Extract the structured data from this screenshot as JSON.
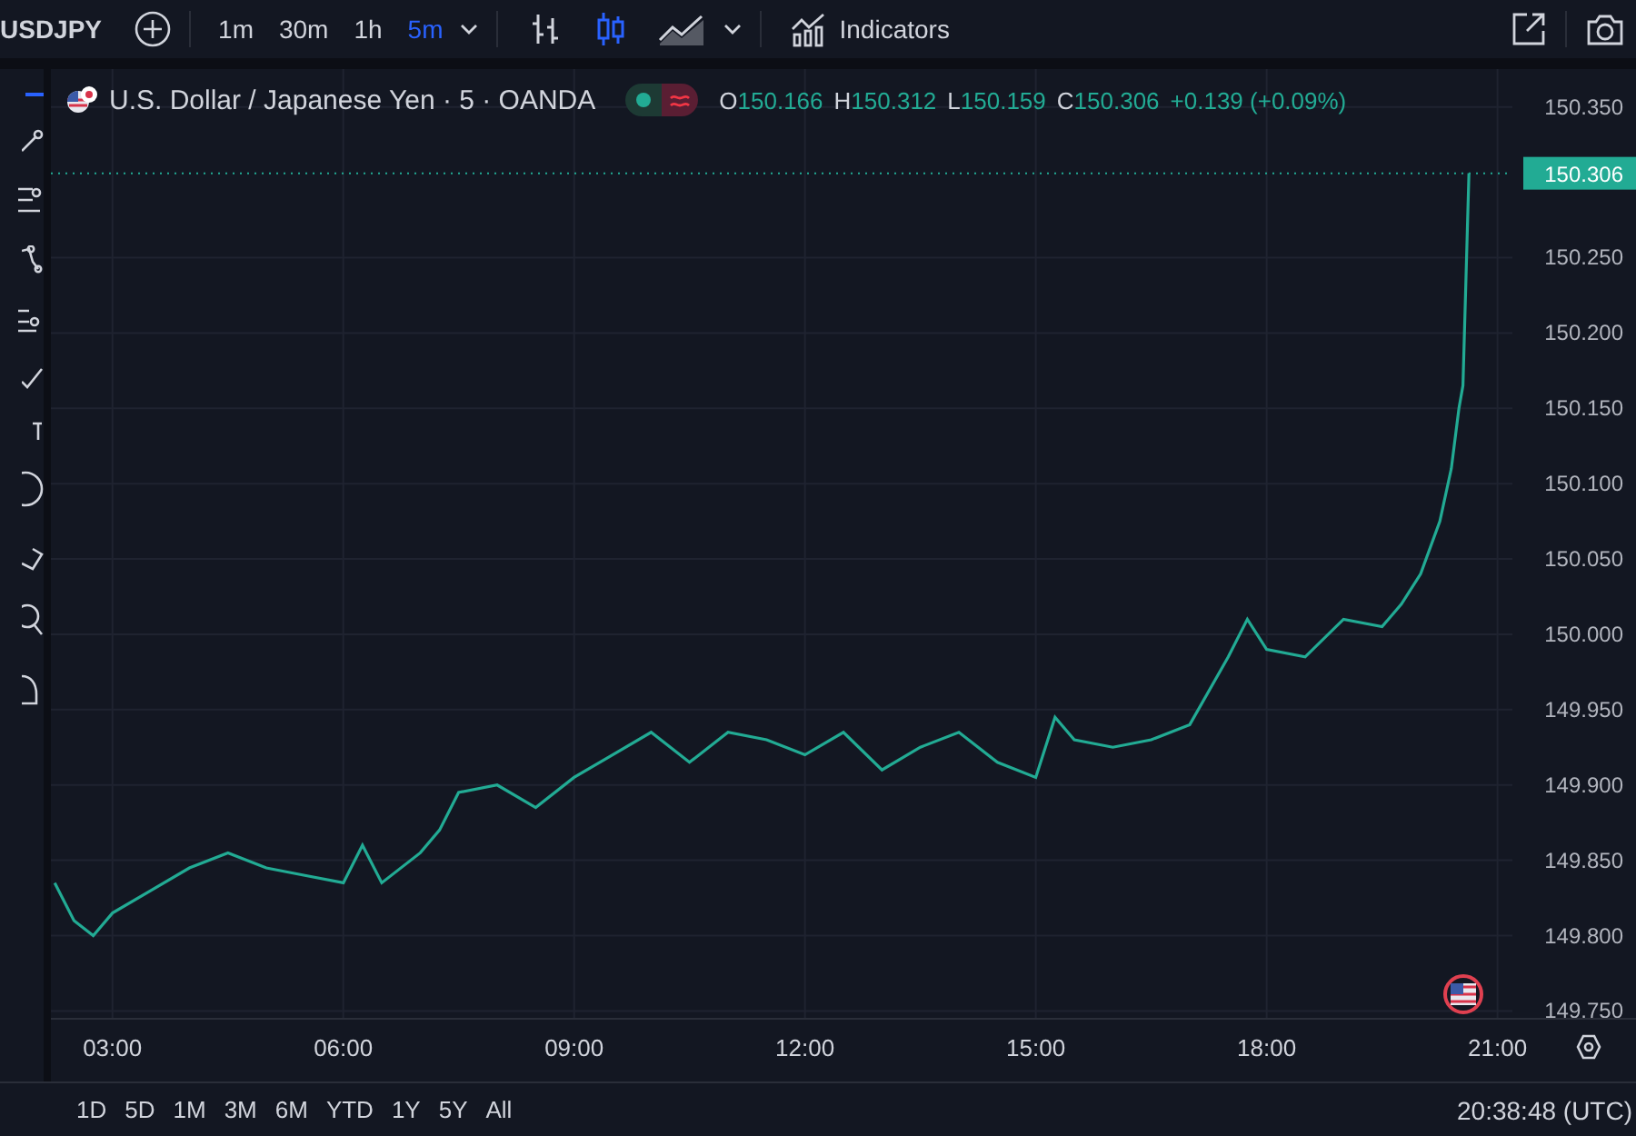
{
  "toolbar": {
    "symbol": "USDJPY",
    "intervals": [
      {
        "label": "1m",
        "selected": false
      },
      {
        "label": "30m",
        "selected": false
      },
      {
        "label": "1h",
        "selected": false
      },
      {
        "label": "5m",
        "selected": true
      }
    ],
    "chart_styles": [
      {
        "kind": "bars",
        "selected": false
      },
      {
        "kind": "candles",
        "selected": true
      },
      {
        "kind": "area",
        "selected": false
      }
    ],
    "indicators_label": "Indicators"
  },
  "legend": {
    "title": "U.S. Dollar / Japanese Yen · 5 · OANDA",
    "market_open": true,
    "ohlc": [
      {
        "label": "O",
        "value": "150.166"
      },
      {
        "label": "H",
        "value": "150.312"
      },
      {
        "label": "L",
        "value": "150.159"
      },
      {
        "label": "C",
        "value": "150.306"
      }
    ],
    "change": "+0.139 (+0.09%)"
  },
  "chart": {
    "last_price": "150.306",
    "chart_data": {
      "type": "line",
      "xlim": [
        2.2,
        22.8
      ],
      "ylim": [
        149.667,
        150.421
      ],
      "grid": true,
      "ref_lines": [
        {
          "axis": "y",
          "value": 150.306,
          "color": "#22ab94"
        }
      ],
      "x": [
        2.25,
        2.5,
        2.75,
        3.0,
        3.5,
        4.0,
        4.5,
        5.0,
        5.5,
        6.0,
        6.25,
        6.5,
        7.0,
        7.25,
        7.5,
        8.0,
        8.5,
        9.0,
        9.5,
        10.0,
        10.5,
        11.0,
        11.5,
        12.0,
        12.5,
        13.0,
        13.5,
        14.0,
        14.5,
        15.0,
        15.25,
        15.5,
        16.0,
        16.5,
        17.0,
        17.5,
        17.75,
        18.0,
        18.5,
        19.0,
        19.5,
        19.75,
        20.0,
        20.25,
        20.4,
        20.5,
        20.55,
        20.63
      ],
      "series": [
        {
          "color": "#22ab94",
          "values": [
            149.835,
            149.81,
            149.8,
            149.815,
            149.83,
            149.845,
            149.855,
            149.845,
            149.84,
            149.835,
            149.86,
            149.835,
            149.855,
            149.87,
            149.895,
            149.9,
            149.885,
            149.905,
            149.92,
            149.935,
            149.915,
            149.935,
            149.93,
            149.92,
            149.935,
            149.91,
            149.925,
            149.935,
            149.915,
            149.905,
            149.945,
            149.93,
            149.925,
            149.93,
            149.94,
            149.985,
            150.01,
            149.99,
            149.985,
            150.01,
            150.005,
            150.02,
            150.04,
            150.075,
            150.11,
            150.15,
            150.165,
            150.306
          ]
        }
      ],
      "xticks": [
        {
          "value": 3,
          "label": "03:00"
        },
        {
          "value": 6,
          "label": "06:00"
        },
        {
          "value": 9,
          "label": "09:00"
        },
        {
          "value": 12,
          "label": "12:00"
        },
        {
          "value": 15,
          "label": "15:00"
        },
        {
          "value": 18,
          "label": "18:00"
        },
        {
          "value": 21,
          "label": "21:00"
        }
      ],
      "yticks": [
        {
          "value": 149.75,
          "label": "149.750"
        },
        {
          "value": 149.8,
          "label": "149.800"
        },
        {
          "value": 149.85,
          "label": "149.850"
        },
        {
          "value": 149.9,
          "label": "149.900"
        },
        {
          "value": 149.95,
          "label": "149.950"
        },
        {
          "value": 150.0,
          "label": "150.000"
        },
        {
          "value": 150.05,
          "label": "150.050"
        },
        {
          "value": 150.1,
          "label": "150.100"
        },
        {
          "value": 150.15,
          "label": "150.150"
        },
        {
          "value": 150.2,
          "label": "150.200"
        },
        {
          "value": 150.25,
          "label": "150.250"
        },
        {
          "value": 150.35,
          "label": "150.350"
        }
      ]
    }
  },
  "bottom_bar": {
    "ranges": [
      "1D",
      "5D",
      "1M",
      "3M",
      "6M",
      "YTD",
      "1Y",
      "5Y",
      "All"
    ],
    "clock": "20:38:48 (UTC)"
  }
}
